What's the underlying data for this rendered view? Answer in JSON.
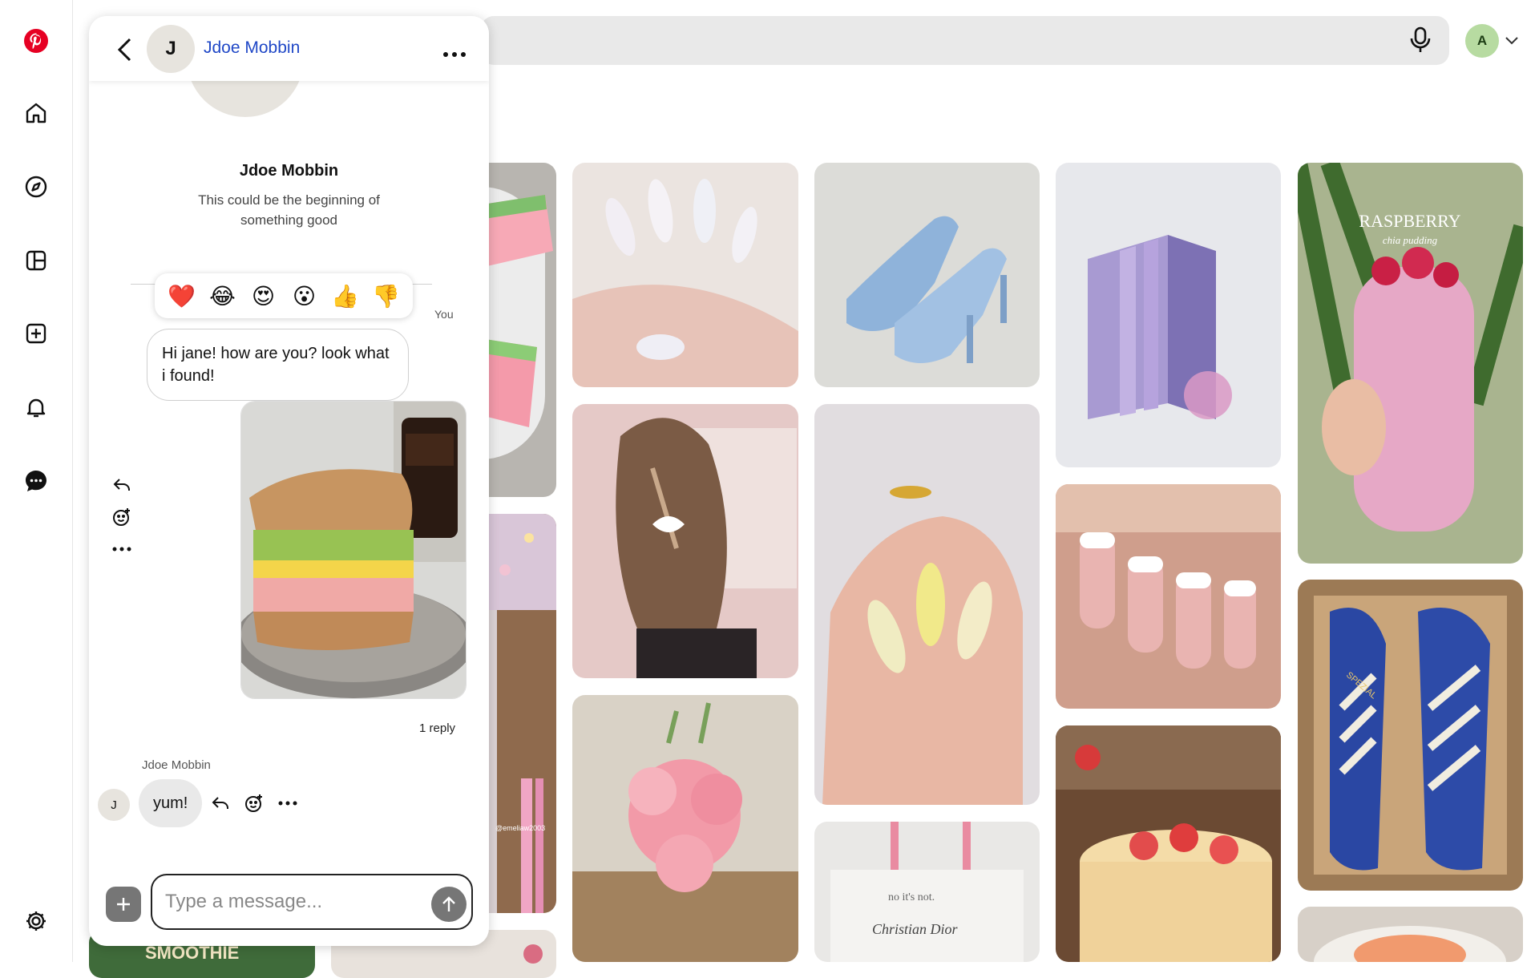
{
  "app": {
    "name": "Pinterest",
    "brand_color": "#e60023"
  },
  "rail": {
    "items": [
      {
        "name": "pinterest-logo",
        "icon": "pinterest-logo-icon"
      },
      {
        "name": "home",
        "icon": "home-icon"
      },
      {
        "name": "explore",
        "icon": "compass-icon"
      },
      {
        "name": "boards",
        "icon": "boards-icon"
      },
      {
        "name": "create",
        "icon": "plus-square-icon"
      },
      {
        "name": "notifications",
        "icon": "bell-icon"
      },
      {
        "name": "messages",
        "icon": "chat-icon"
      },
      {
        "name": "settings",
        "icon": "gear-icon"
      }
    ]
  },
  "topbar": {
    "account_initial": "A"
  },
  "pins": [
    {
      "subject": "watermelon sandwich"
    },
    {
      "subject": "chrome almond nails"
    },
    {
      "subject": "blue bow heels"
    },
    {
      "subject": "pastel book set"
    },
    {
      "subject": "raspberry chia pudding",
      "overlay_title": "RASPBERRY",
      "overlay_sub": "chia pudding"
    },
    {
      "subject": "beads and tweezers",
      "overlay_credit": "@emeliaw2003"
    },
    {
      "subject": "braided hair bow"
    },
    {
      "subject": "yellow floral nails"
    },
    {
      "subject": "french tip nails"
    },
    {
      "subject": "blue adidas sneakers",
      "overlay_brand": "SPEZIAL"
    },
    {
      "subject": "pink lily bouquet"
    },
    {
      "subject": "dior tote bag",
      "overlay_text_1": "no it's not.",
      "overlay_text_2": "Christian Dior"
    },
    {
      "subject": "strawberry crepe cake"
    },
    {
      "subject": "smoothie",
      "overlay_text": "SMOOTHIE"
    },
    {
      "subject": "salmon toast"
    }
  ],
  "chat": {
    "header": {
      "avatar_initial": "J",
      "name": "Jdoe Mobbin"
    },
    "intro": {
      "name": "Jdoe Mobbin",
      "subtitle": "This could be the beginning of something good"
    },
    "reactions": [
      "❤️",
      "😂",
      "😍",
      "😮",
      "👍",
      "👎"
    ],
    "outgoing": {
      "label": "You",
      "text": "Hi jane! how are you? look what i found!",
      "attachment": "sandwich photo"
    },
    "reply_count": "1 reply",
    "incoming": {
      "sender": "Jdoe Mobbin",
      "avatar_initial": "J",
      "text": "yum!"
    },
    "composer": {
      "placeholder": "Type a message..."
    }
  }
}
